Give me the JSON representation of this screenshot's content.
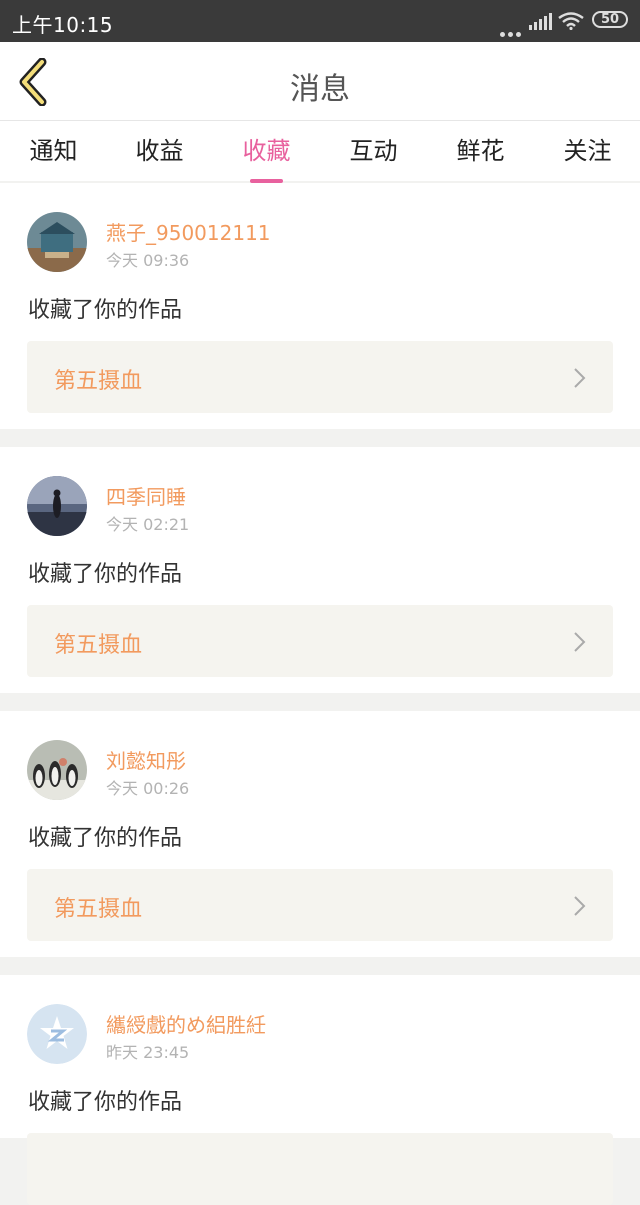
{
  "status_bar": {
    "time": "上午10:15",
    "battery": "50"
  },
  "header": {
    "title": "消息"
  },
  "tabs": [
    {
      "label": "通知"
    },
    {
      "label": "收益"
    },
    {
      "label": "收藏"
    },
    {
      "label": "互动"
    },
    {
      "label": "鲜花"
    },
    {
      "label": "关注"
    }
  ],
  "active_tab": "收藏",
  "colors": {
    "accent": "#e8619e",
    "name": "#f29a5e",
    "card_bg": "#f5f4ef"
  },
  "messages": [
    {
      "user": "燕子_950012111",
      "time": "今天 09:36",
      "action": "收藏了你的作品",
      "work": "第五摄血",
      "avatar_icon": "avatar-photo-carousel"
    },
    {
      "user": "四季同睡",
      "time": "今天 02:21",
      "action": "收藏了你的作品",
      "work": "第五摄血",
      "avatar_icon": "avatar-photo-silhouette"
    },
    {
      "user": "刘懿知彤",
      "time": "今天 00:26",
      "action": "收藏了你的作品",
      "work": "第五摄血",
      "avatar_icon": "avatar-photo-penguins"
    },
    {
      "user": "纗綬戲的め絽胜紝",
      "time": "昨天 23:45",
      "action": "收藏了你的作品",
      "work": "",
      "avatar_icon": "avatar-default-z"
    }
  ]
}
